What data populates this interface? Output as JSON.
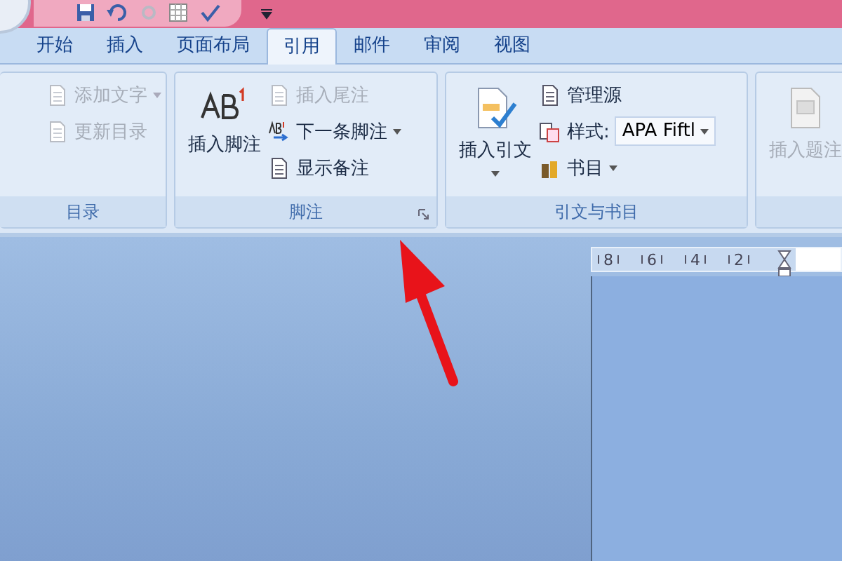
{
  "tabs": [
    {
      "label": "开始",
      "selected": false
    },
    {
      "label": "插入",
      "selected": false
    },
    {
      "label": "页面布局",
      "selected": false
    },
    {
      "label": "引用",
      "selected": true
    },
    {
      "label": "邮件",
      "selected": false
    },
    {
      "label": "审阅",
      "selected": false
    },
    {
      "label": "视图",
      "selected": false
    }
  ],
  "groups": [
    {
      "label": "目录",
      "launcher": false,
      "columns": [
        [
          {
            "kind": "small",
            "label": "添加文字",
            "disabled": true,
            "dropdown": true
          },
          {
            "kind": "small",
            "label": "更新目录",
            "disabled": true,
            "dropdown": false
          }
        ]
      ]
    },
    {
      "label": "脚注",
      "launcher": true,
      "columns": [
        [
          {
            "kind": "large",
            "label": "插入脚注",
            "disabled": false,
            "dropdown": false
          }
        ],
        [
          {
            "kind": "small",
            "label": "插入尾注",
            "disabled": true,
            "dropdown": false
          },
          {
            "kind": "small",
            "label": "下一条脚注",
            "disabled": false,
            "dropdown": true
          },
          {
            "kind": "small",
            "label": "显示备注",
            "disabled": false,
            "dropdown": false
          }
        ]
      ]
    },
    {
      "label": "引文与书目",
      "launcher": false,
      "columns": [
        [
          {
            "kind": "large",
            "label": "插入引文",
            "disabled": false,
            "dropdown": true
          }
        ],
        [
          {
            "kind": "small",
            "label": "管理源",
            "disabled": false,
            "dropdown": false
          },
          {
            "kind": "combo",
            "label": "样式:",
            "value": "APA Fiftl"
          },
          {
            "kind": "small",
            "label": "书目",
            "disabled": false,
            "dropdown": true
          }
        ]
      ]
    },
    {
      "launcher": false,
      "columns": [
        [
          {
            "kind": "large",
            "label": "插入题注",
            "disabled": true,
            "dropdown": false
          }
        ]
      ]
    }
  ],
  "ruler": {
    "labels": [
      "8",
      "6",
      "4",
      "2"
    ]
  }
}
